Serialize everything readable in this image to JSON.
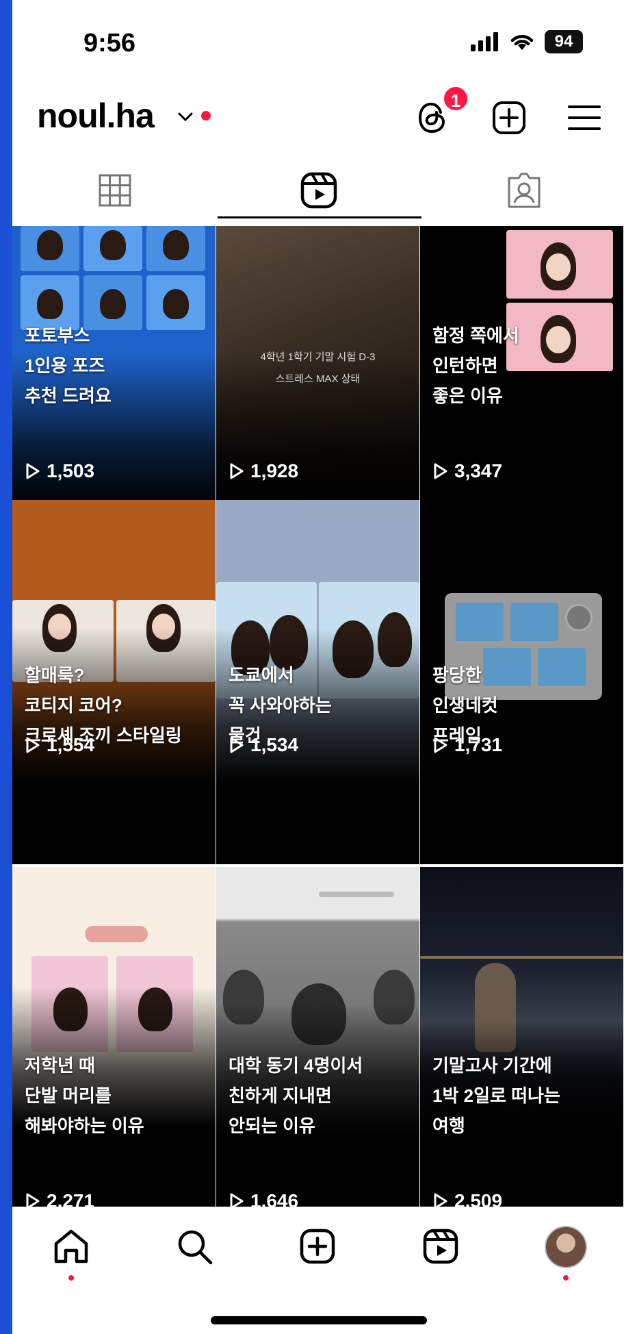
{
  "status_bar": {
    "time": "9:56",
    "battery": "94"
  },
  "header": {
    "username": "noul.ha",
    "threads_badge": "1"
  },
  "icons": {
    "threads": "threads-icon",
    "create": "plus-square-icon",
    "menu": "hamburger-menu-icon",
    "grid_tab": "grid-icon",
    "reels_tab": "reels-icon",
    "tagged_tab": "tagged-person-icon",
    "home": "home-icon",
    "search": "search-icon",
    "add": "add-post-icon",
    "reels": "reels-icon",
    "profile": "profile-avatar"
  },
  "colors": {
    "accent_red": "#ff1744",
    "background": "#ffffff",
    "text": "#000000"
  },
  "reels": [
    {
      "caption": "포토부스\n1인용 포즈\n추천 드려요",
      "views": "1,503"
    },
    {
      "caption": "",
      "overlay_text": "4학년 1학기 기말 시험 D-3\n스트레스 MAX 상태",
      "views": "1,928"
    },
    {
      "caption": "함정 쪽에서\n인턴하면\n좋은 이유",
      "views": "3,347"
    },
    {
      "caption": "할매룩?\n코티지 코어?\n크로셰 조끼 스타일링",
      "views": "1,554"
    },
    {
      "caption": "도쿄에서\n꼭 사와야하는\n물건",
      "views": "1,534"
    },
    {
      "caption": "팡당한\n인생네컷\n프레임",
      "views": "1,731"
    },
    {
      "caption": "저학년 때\n단발 머리를\n해봐야하는 이유",
      "views": "2,271"
    },
    {
      "caption": "대학 동기 4명이서\n친하게 지내면\n안되는 이유",
      "views": "1,646"
    },
    {
      "caption": "기말고사 기간에\n1박 2일로 떠나는\n여행",
      "views": "2,509"
    }
  ]
}
